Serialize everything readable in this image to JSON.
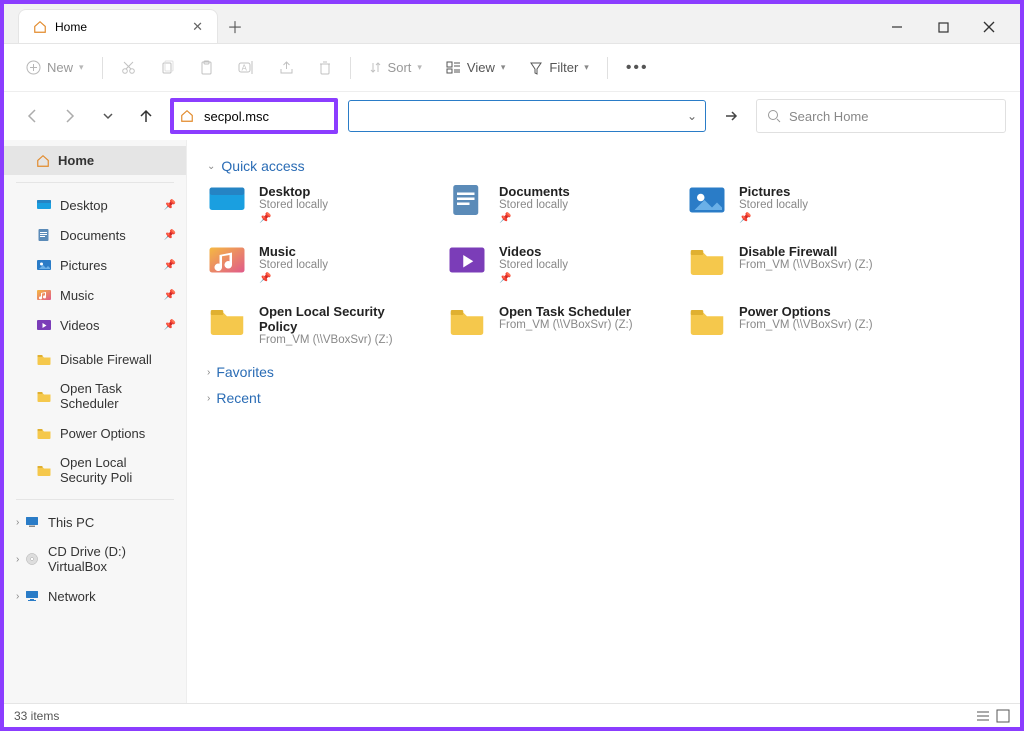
{
  "window": {
    "tab_title": "Home"
  },
  "toolbar": {
    "new": "New",
    "sort": "Sort",
    "view": "View",
    "filter": "Filter"
  },
  "nav": {
    "address_value": "secpol.msc",
    "search_placeholder": "Search Home"
  },
  "sidebar": {
    "home": "Home",
    "pinned": [
      {
        "label": "Desktop",
        "icon": "desktop"
      },
      {
        "label": "Documents",
        "icon": "documents"
      },
      {
        "label": "Pictures",
        "icon": "pictures"
      },
      {
        "label": "Music",
        "icon": "music"
      },
      {
        "label": "Videos",
        "icon": "videos"
      }
    ],
    "folders": [
      {
        "label": "Disable Firewall"
      },
      {
        "label": "Open Task Scheduler"
      },
      {
        "label": "Power Options"
      },
      {
        "label": "Open Local Security Poli"
      }
    ],
    "bottom": [
      {
        "label": "This PC",
        "icon": "pc"
      },
      {
        "label": "CD Drive (D:) VirtualBox",
        "icon": "cd"
      },
      {
        "label": "Network",
        "icon": "network"
      }
    ]
  },
  "sections": {
    "quick_access": "Quick access",
    "favorites": "Favorites",
    "recent": "Recent"
  },
  "quick_access": [
    {
      "title": "Desktop",
      "sub": "Stored locally",
      "icon": "desktop",
      "pin": true
    },
    {
      "title": "Documents",
      "sub": "Stored locally",
      "icon": "documents",
      "pin": true
    },
    {
      "title": "Pictures",
      "sub": "Stored locally",
      "icon": "pictures",
      "pin": true
    },
    {
      "title": "Music",
      "sub": "Stored locally",
      "icon": "music",
      "pin": true
    },
    {
      "title": "Videos",
      "sub": "Stored locally",
      "icon": "videos",
      "pin": true
    },
    {
      "title": "Disable Firewall",
      "sub": "From_VM (\\\\VBoxSvr) (Z:)",
      "icon": "folder",
      "pin": false
    },
    {
      "title": "Open Local Security Policy",
      "sub": "From_VM (\\\\VBoxSvr) (Z:)",
      "icon": "folder",
      "pin": false
    },
    {
      "title": "Open Task Scheduler",
      "sub": "From_VM (\\\\VBoxSvr) (Z:)",
      "icon": "folder",
      "pin": false
    },
    {
      "title": "Power Options",
      "sub": "From_VM (\\\\VBoxSvr) (Z:)",
      "icon": "folder",
      "pin": false
    }
  ],
  "status": {
    "count": "33 items"
  }
}
